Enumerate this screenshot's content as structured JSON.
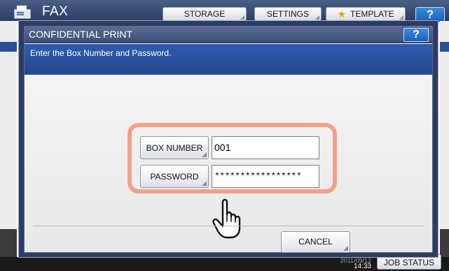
{
  "background": {
    "app_title": "FAX",
    "toolbar": {
      "storage_label": "STORAGE",
      "settings_label": "SETTINGS",
      "template_label": "TEMPLATE",
      "help_label": "?"
    },
    "clock": {
      "date": "2011/09/12",
      "time": "14:33"
    },
    "job_status_label": "JOB STATUS"
  },
  "dialog": {
    "title": "CONFIDENTIAL PRINT",
    "help_label": "?",
    "message": "Enter the Box Number and Password.",
    "box_number": {
      "label": "BOX NUMBER",
      "value": "001"
    },
    "password": {
      "label": "PASSWORD",
      "value": "*****************"
    },
    "cancel_label": "CANCEL"
  },
  "colors": {
    "header": "#3d4f77",
    "message_bar": "#2f5cae",
    "highlight": "#f2a08a",
    "help_button": "#1a5fb8"
  },
  "icons": [
    "fax-icon",
    "star-icon",
    "pointing-hand-icon"
  ]
}
